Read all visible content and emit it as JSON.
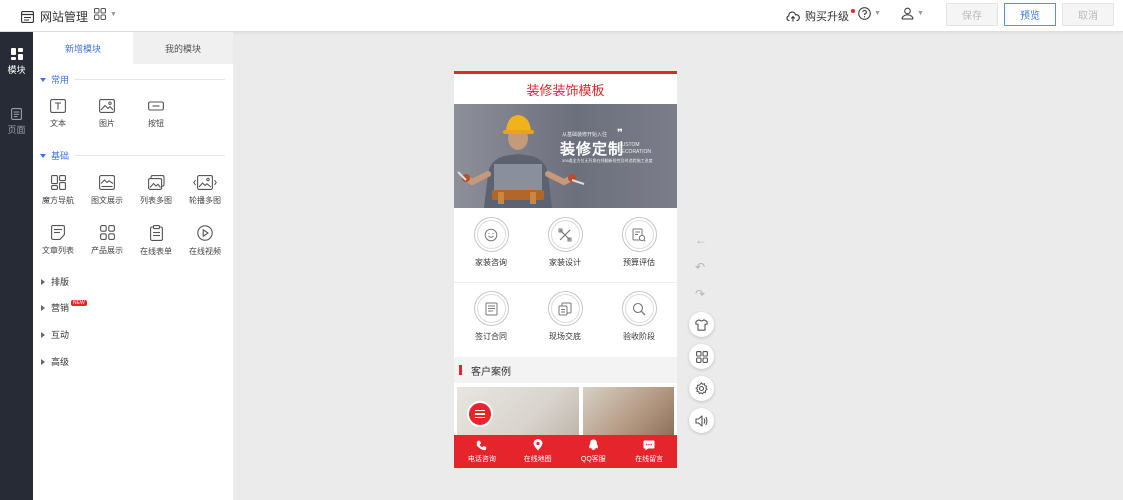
{
  "topbar": {
    "app_title": "网站管理",
    "upgrade_label": "购买升级",
    "buttons": {
      "save": "保存",
      "preview": "预览",
      "cancel": "取消"
    }
  },
  "rail": {
    "items": [
      {
        "label": "模块",
        "icon": "modules-icon",
        "active": true
      },
      {
        "label": "页面",
        "icon": "page-icon",
        "active": false
      }
    ]
  },
  "panel": {
    "tabs": [
      {
        "label": "新增模块",
        "active": true
      },
      {
        "label": "我的模块",
        "active": false
      }
    ],
    "groups": {
      "common": {
        "title": "常用",
        "items": [
          {
            "label": "文本",
            "icon": "text-icon"
          },
          {
            "label": "图片",
            "icon": "image-icon"
          },
          {
            "label": "按钮",
            "icon": "button-icon"
          }
        ]
      },
      "basic": {
        "title": "基础",
        "items": [
          {
            "label": "魔方导航",
            "icon": "cube-nav-icon"
          },
          {
            "label": "图文展示",
            "icon": "image-text-icon"
          },
          {
            "label": "列表多图",
            "icon": "multi-image-icon"
          },
          {
            "label": "轮播多图",
            "icon": "carousel-icon"
          },
          {
            "label": "文章列表",
            "icon": "article-list-icon"
          },
          {
            "label": "产品展示",
            "icon": "product-icon"
          },
          {
            "label": "在线表单",
            "icon": "form-icon"
          },
          {
            "label": "在线视频",
            "icon": "video-icon"
          }
        ]
      }
    },
    "collapsed_groups": [
      {
        "label": "排版",
        "badge": ""
      },
      {
        "label": "营销",
        "badge": "NEW"
      },
      {
        "label": "互动",
        "badge": ""
      },
      {
        "label": "高级",
        "badge": ""
      }
    ]
  },
  "phone": {
    "title": "装修装饰模板",
    "banner": {
      "headline": "装修定制",
      "tagline": "从基础装修开始入住",
      "english": "CUSTOM DECORATION",
      "subtext": "306道全方位无死角在线翻新检控及时追踪施工进度"
    },
    "grid": [
      {
        "label": "家装咨询",
        "icon": "chat-icon"
      },
      {
        "label": "家装设计",
        "icon": "design-tools-icon"
      },
      {
        "label": "预算评估",
        "icon": "budget-icon"
      },
      {
        "label": "签订合同",
        "icon": "contract-icon"
      },
      {
        "label": "现场交底",
        "icon": "onsite-icon"
      },
      {
        "label": "验收阶段",
        "icon": "inspect-icon"
      }
    ],
    "section_title": "客户案例",
    "footer": [
      {
        "label": "电话咨询",
        "icon": "phone-icon"
      },
      {
        "label": "在线地图",
        "icon": "map-pin-icon"
      },
      {
        "label": "QQ客服",
        "icon": "qq-icon"
      },
      {
        "label": "在线留言",
        "icon": "message-icon"
      }
    ]
  },
  "colors": {
    "accent": "#3d75d6",
    "brand_red": "#e5242b",
    "rail_bg": "#272b35",
    "canvas_bg": "#ebebeb"
  }
}
